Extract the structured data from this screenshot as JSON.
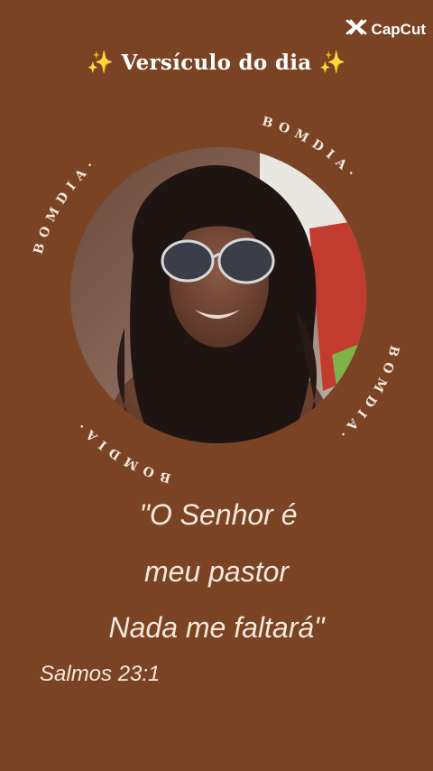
{
  "watermark": {
    "label": "CapCut",
    "icon": "capcut-logo-icon"
  },
  "header": {
    "sparkle_left": "✨",
    "title": "Versículo do dia",
    "sparkle_right": "✨"
  },
  "badge": {
    "ring_text": "BOM DIA",
    "separator": "·",
    "photo_icon": "portrait-photo"
  },
  "verse": {
    "lines": [
      "\"O Senhor é",
      "meu pastor",
      "Nada me faltará\""
    ],
    "reference": "Salmos 23:1"
  },
  "colors": {
    "background": "#7a4424",
    "text": "#f3e7dc",
    "sparkle": "#f6c945"
  }
}
